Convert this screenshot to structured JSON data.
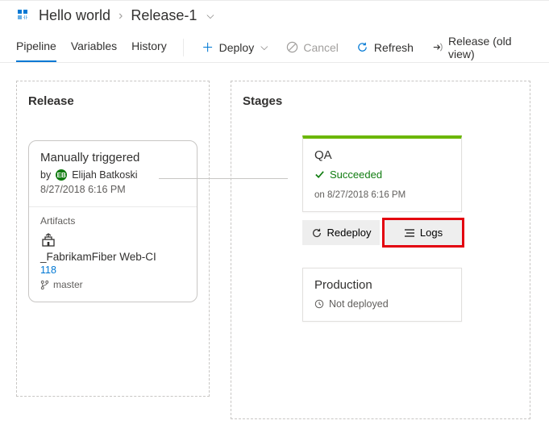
{
  "breadcrumb": {
    "root": "Hello world",
    "current": "Release-1"
  },
  "tabs": {
    "pipeline": "Pipeline",
    "variables": "Variables",
    "history": "History"
  },
  "actions": {
    "deploy": "Deploy",
    "cancel": "Cancel",
    "refresh": "Refresh",
    "oldview": "Release (old view)"
  },
  "panels": {
    "release_title": "Release",
    "stages_title": "Stages"
  },
  "release": {
    "trigger": "Manually triggered",
    "by_prefix": "by",
    "user": "Elijah Batkoski",
    "timestamp": "8/27/2018 6:16 PM",
    "artifacts_label": "Artifacts",
    "artifact_name": "_FabrikamFiber Web-CI",
    "artifact_build": "118",
    "artifact_branch": "master"
  },
  "stages": {
    "qa": {
      "name": "QA",
      "status": "Succeeded",
      "timestamp": "on 8/27/2018 6:16 PM",
      "redeploy": "Redeploy",
      "logs": "Logs"
    },
    "prod": {
      "name": "Production",
      "status": "Not deployed"
    }
  }
}
